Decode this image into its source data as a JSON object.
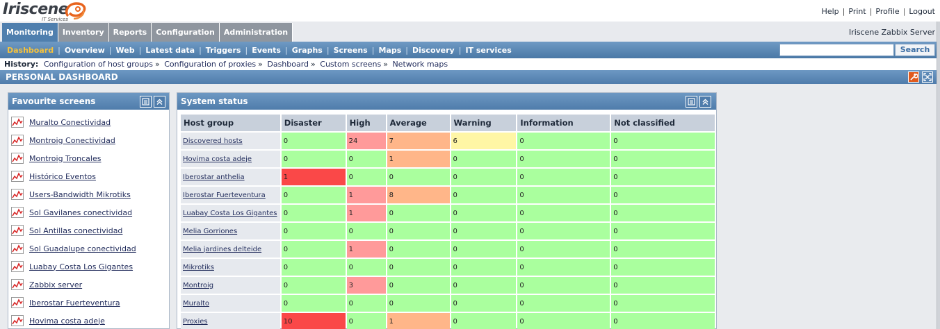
{
  "brand": {
    "name": "Iriscene",
    "tagline": "IT Services"
  },
  "top_links": [
    "Help",
    "Print",
    "Profile",
    "Logout"
  ],
  "main_menu": {
    "tabs": [
      "Monitoring",
      "Inventory",
      "Reports",
      "Configuration",
      "Administration"
    ],
    "active": "Monitoring",
    "server_name": "Iriscene Zabbix Server"
  },
  "sub_menu": {
    "items": [
      "Dashboard",
      "Overview",
      "Web",
      "Latest data",
      "Triggers",
      "Events",
      "Graphs",
      "Screens",
      "Maps",
      "Discovery",
      "IT services"
    ],
    "active": "Dashboard"
  },
  "search": {
    "value": "",
    "button_label": "Search"
  },
  "history": {
    "label": "History:",
    "items": [
      "Configuration of host groups",
      "Configuration of proxies",
      "Dashboard",
      "Custom screens",
      "Network maps"
    ]
  },
  "page_title": "PERSONAL DASHBOARD",
  "favourite_screens": {
    "title": "Favourite screens",
    "items": [
      "Muralto Conectividad",
      "Montroig Conectividad",
      "Montroig Troncales",
      "Histórico Eventos",
      "Users-Bandwidth Mikrotiks",
      "Sol Gavilanes conectividad",
      "Sol Antillas conectividad",
      "Sol Guadalupe conectividad",
      "Luabay Costa Los Gigantes",
      "Zabbix server",
      "Iberostar Fuerteventura",
      "Hovima costa adeje"
    ]
  },
  "system_status": {
    "title": "System status",
    "columns": [
      "Host group",
      "Disaster",
      "High",
      "Average",
      "Warning",
      "Information",
      "Not classified"
    ],
    "rows": [
      {
        "group": "Discovered hosts",
        "values": [
          "0",
          "24",
          "7",
          "6",
          "0",
          "0"
        ]
      },
      {
        "group": "Hovima costa adeje",
        "values": [
          "0",
          "0",
          "1",
          "0",
          "0",
          "0"
        ]
      },
      {
        "group": "Iberostar anthelia",
        "values": [
          "1",
          "0",
          "0",
          "0",
          "0",
          "0"
        ]
      },
      {
        "group": "Iberostar Fuerteventura",
        "values": [
          "0",
          "1",
          "8",
          "0",
          "0",
          "0"
        ]
      },
      {
        "group": "Luabay Costa Los Gigantes",
        "values": [
          "0",
          "1",
          "0",
          "0",
          "0",
          "0"
        ]
      },
      {
        "group": "Melia Gorriones",
        "values": [
          "0",
          "0",
          "0",
          "0",
          "0",
          "0"
        ]
      },
      {
        "group": "Melia jardines delteide",
        "values": [
          "0",
          "1",
          "0",
          "0",
          "0",
          "0"
        ]
      },
      {
        "group": "Mikrotiks",
        "values": [
          "0",
          "0",
          "0",
          "0",
          "0",
          "0"
        ]
      },
      {
        "group": "Montroig",
        "values": [
          "0",
          "3",
          "0",
          "0",
          "0",
          "0"
        ]
      },
      {
        "group": "Muralto",
        "values": [
          "0",
          "0",
          "0",
          "0",
          "0",
          "0"
        ]
      },
      {
        "group": "Proxies",
        "values": [
          "10",
          "0",
          "1",
          "0",
          "0",
          "0"
        ]
      }
    ]
  },
  "colors": {
    "accent": "#4f7cab",
    "ok": "#aaff9e",
    "disaster": "#fa4848",
    "high": "#ff9a9a",
    "average": "#ffb689",
    "warning": "#fff6a5",
    "active_menu_text": "#f6c23a"
  },
  "icons": {
    "favourite_item": "graph-icon",
    "widget_menu": "list-icon",
    "widget_collapse": "collapse-icon",
    "tools": "wrench-icon",
    "fullscreen": "fullscreen-icon"
  }
}
